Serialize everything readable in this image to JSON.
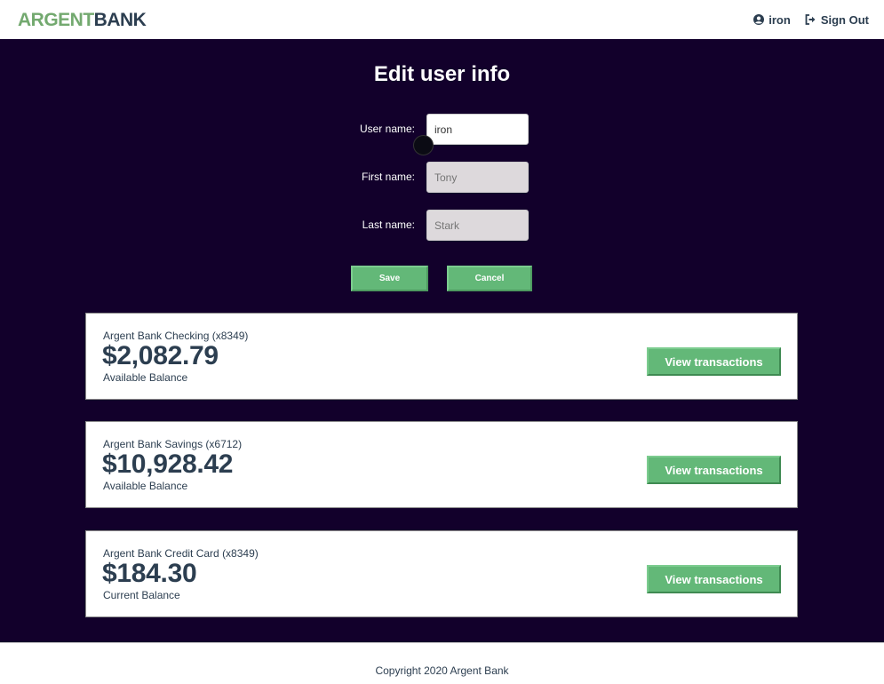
{
  "nav": {
    "logo_part1": "ARGENT",
    "logo_part2": "BANK",
    "user_label": "iron",
    "signout_label": "Sign Out"
  },
  "form": {
    "title": "Edit user info",
    "username_label": "User name:",
    "username_value": "iron",
    "firstname_label": "First name:",
    "firstname_placeholder": "Tony",
    "lastname_label": "Last name:",
    "lastname_placeholder": "Stark",
    "save_label": "Save",
    "cancel_label": "Cancel"
  },
  "accounts": [
    {
      "title": "Argent Bank Checking (x8349)",
      "amount": "$2,082.79",
      "description": "Available Balance",
      "button": "View transactions"
    },
    {
      "title": "Argent Bank Savings (x6712)",
      "amount": "$10,928.42",
      "description": "Available Balance",
      "button": "View transactions"
    },
    {
      "title": "Argent Bank Credit Card (x8349)",
      "amount": "$184.30",
      "description": "Current Balance",
      "button": "View transactions"
    }
  ],
  "footer": {
    "text": "Copyright 2020 Argent Bank"
  },
  "colors": {
    "accent": "#63b878",
    "background": "#12002b",
    "text": "#2c3e50"
  }
}
